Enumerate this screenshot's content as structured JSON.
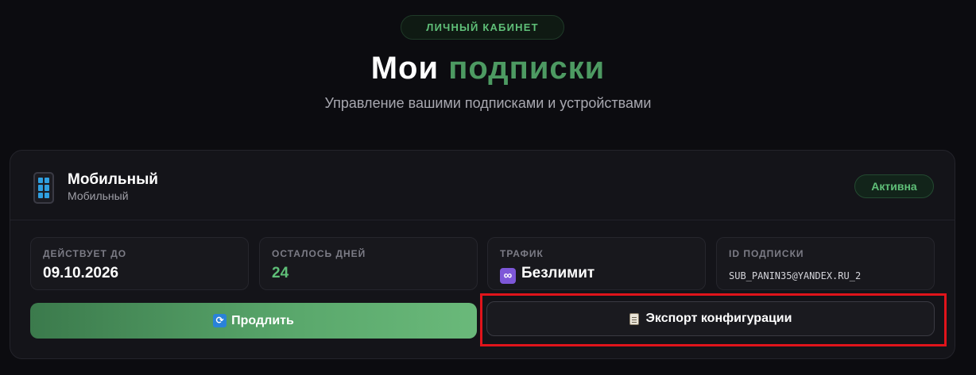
{
  "header": {
    "badge": "ЛИЧНЫЙ КАБИНЕТ",
    "title_main": "Мои",
    "title_accent": "подписки",
    "subtitle": "Управление вашими подписками и устройствами"
  },
  "subscription": {
    "icon": "mobile-phone-icon",
    "name": "Мобильный",
    "type": "Мобильный",
    "status": "Активна",
    "stats": [
      {
        "label": "ДЕЙСТВУЕТ ДО",
        "value": "09.10.2026"
      },
      {
        "label": "ОСТАЛОСЬ ДНЕЙ",
        "value": "24"
      },
      {
        "label": "ТРАФИК",
        "value": "Безлимит",
        "icon": "infinity-icon"
      },
      {
        "label": "ID ПОДПИСКИ",
        "value": "SUB_PANIN35@YANDEX.RU_2"
      }
    ],
    "actions": {
      "renew_label": "Продлить",
      "renew_icon": "refresh-icon",
      "export_label": "Экспорт конфигурации",
      "export_icon": "clipboard-icon"
    }
  },
  "colors": {
    "accent": "#4d9a62",
    "status": "#5fbf78",
    "highlight": "#e0141b"
  }
}
